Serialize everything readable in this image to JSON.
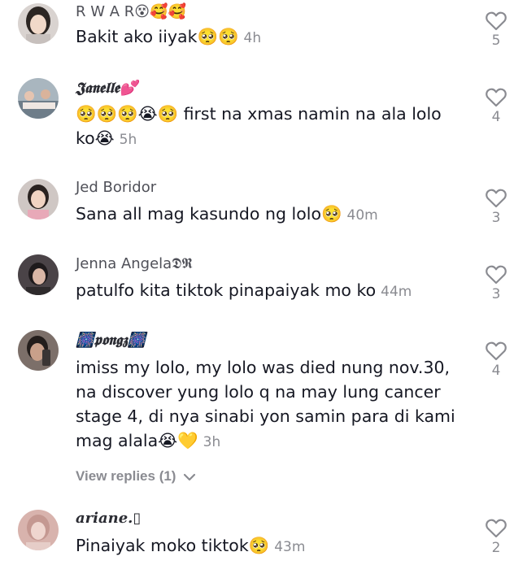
{
  "comments": [
    {
      "username": "R W A R😵🥰🥰",
      "text": "Bakit ako iiyak🥺🥺",
      "time": "4h",
      "likes": "5"
    },
    {
      "username": "𝕵𝖆𝖓𝖊𝖑𝖑𝖊💕",
      "text": "🥺🥺🥺😭🥺 first na xmas namin na ala lolo ko😭",
      "time": "5h",
      "likes": "4"
    },
    {
      "username": "Jed Boridor",
      "text": "Sana all mag kasundo ng lolo🥺",
      "time": "40m",
      "likes": "3"
    },
    {
      "username": "Jenna Angela𝕯𝕽",
      "text": "patulfo kita tiktok pinapaiyak mo ko",
      "time": "44m",
      "likes": "3"
    },
    {
      "username": "🎆𝖕𝖔𝖓𝖌𝖟🎆",
      "text": "imiss my lolo, my lolo was died nung nov.30, na discover yung lolo q na may lung cancer stage 4, di nya sinabi yon samin para di kami mag alala😭💛",
      "time": "3h",
      "likes": "4"
    },
    {
      "username": "𝒂𝒓𝒊𝒂𝒏𝒆.▯",
      "text": "Pinaiyak moko tiktok🥺",
      "time": "43m",
      "likes": "2"
    }
  ],
  "view_replies_label": "View replies (1)",
  "icons": {
    "like": "heart-outline-icon",
    "expand": "chevron-down-icon"
  },
  "colors": {
    "text": "#161823",
    "muted": "#8a8b91",
    "username": "#4f5058",
    "background": "#ffffff"
  }
}
